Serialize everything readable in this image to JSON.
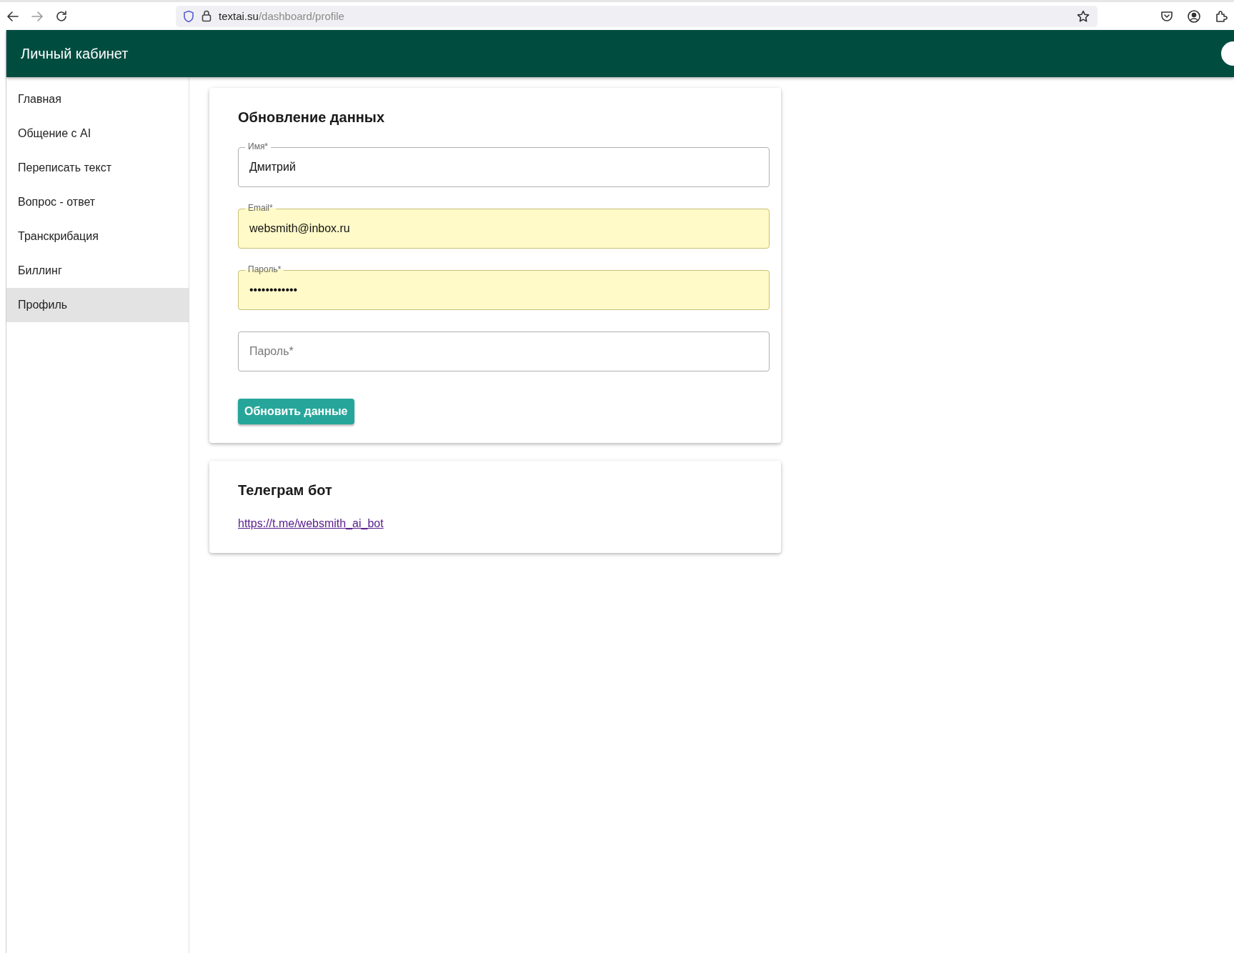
{
  "browser": {
    "url_host": "textai.su",
    "url_path": "/dashboard/profile"
  },
  "header": {
    "title": "Личный кабинет"
  },
  "sidebar": {
    "items": [
      {
        "label": "Главная",
        "selected": false
      },
      {
        "label": "Общение с AI",
        "selected": false
      },
      {
        "label": "Переписать текст",
        "selected": false
      },
      {
        "label": "Вопрос - ответ",
        "selected": false
      },
      {
        "label": "Транскрибация",
        "selected": false
      },
      {
        "label": "Биллинг",
        "selected": false
      },
      {
        "label": "Профиль",
        "selected": true
      }
    ]
  },
  "update_card": {
    "title": "Обновление данных",
    "fields": [
      {
        "label": "Имя*",
        "value": "Дмитрий",
        "autofilled": false
      },
      {
        "label": "Email*",
        "value": "websmith@inbox.ru",
        "autofilled": true
      },
      {
        "label": "Пароль*",
        "value": "••••••••••••",
        "autofilled": true
      },
      {
        "placeholder": "Пароль*",
        "autofilled": false
      }
    ],
    "button": "Обновить данные"
  },
  "telegram_card": {
    "title": "Телеграм бот",
    "link": "https://t.me/websmith_ai_bot"
  }
}
